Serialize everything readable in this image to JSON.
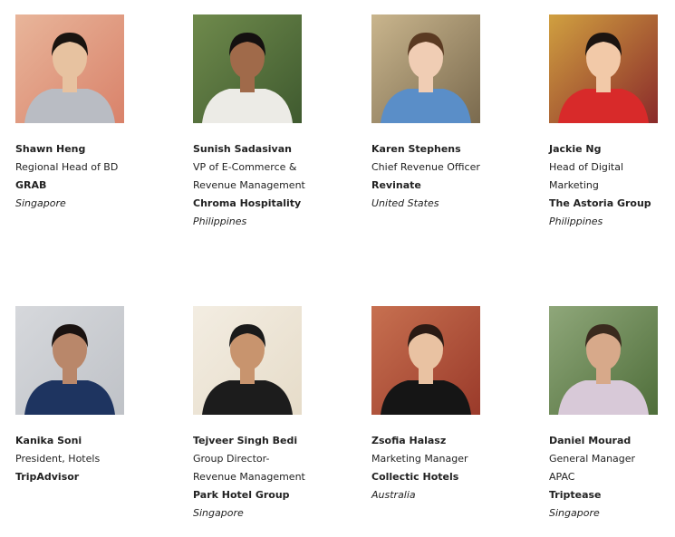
{
  "speakers": [
    {
      "name": "Shawn Heng",
      "role": [
        "Regional Head of BD"
      ],
      "company": "GRAB",
      "country": "Singapore",
      "photo": {
        "bg": "#d9826a",
        "bg2": "#e8b59a",
        "skin": "#e7c2a0",
        "hair": "#1a1410",
        "shirt": "#b9bcc3"
      }
    },
    {
      "name": "Sunish Sadasivan",
      "role": [
        "VP of E-Commerce &",
        "Revenue Management"
      ],
      "company": "Chroma Hospitality",
      "country": "Philippines",
      "photo": {
        "bg": "#3f5a2f",
        "bg2": "#6f8a4c",
        "skin": "#a06a4a",
        "hair": "#141010",
        "shirt": "#ecebe6"
      }
    },
    {
      "name": "Karen Stephens",
      "role": [
        "Chief Revenue Officer"
      ],
      "company": "Revinate",
      "country": "United States",
      "photo": {
        "bg": "#7a6a4e",
        "bg2": "#c9b58d",
        "skin": "#f0cdb4",
        "hair": "#5a3a22",
        "shirt": "#5a8ec8"
      }
    },
    {
      "name": "Jackie Ng",
      "role": [
        "Head of Digital",
        "Marketing"
      ],
      "company": "The Astoria Group",
      "country": "Philippines",
      "photo": {
        "bg": "#8a2a2a",
        "bg2": "#d0a040",
        "skin": "#f2c9a8",
        "hair": "#1c1410",
        "shirt": "#d82a2a"
      }
    },
    {
      "name": "Kanika Soni",
      "role": [
        "President, Hotels"
      ],
      "company": "TripAdvisor",
      "country": "",
      "photo": {
        "bg": "#bfc2c7",
        "bg2": "#d6d8dc",
        "skin": "#b9876a",
        "hair": "#1a1210",
        "shirt": "#1e3460"
      }
    },
    {
      "name": "Tejveer Singh Bedi",
      "role": [
        "Group Director-",
        "Revenue Management"
      ],
      "company": "Park Hotel Group",
      "country": "Singapore",
      "photo": {
        "bg": "#e6dcc9",
        "bg2": "#f3ede2",
        "skin": "#c8946e",
        "hair": "#1a1a1a",
        "shirt": "#1c1c1c"
      }
    },
    {
      "name": "Zsofia Halasz",
      "role": [
        "Marketing Manager"
      ],
      "company": "Collectic Hotels",
      "country": "Australia",
      "photo": {
        "bg": "#9a3a2a",
        "bg2": "#c77050",
        "skin": "#e9c2a2",
        "hair": "#2a1a14",
        "shirt": "#151515"
      }
    },
    {
      "name": "Daniel Mourad",
      "role": [
        "General Manager",
        "APAC"
      ],
      "company": "Triptease",
      "country": "Singapore",
      "photo": {
        "bg": "#4f6e3a",
        "bg2": "#8fa77a",
        "skin": "#d7a98a",
        "hair": "#3a2a1e",
        "shirt": "#d8c9d8"
      }
    }
  ]
}
